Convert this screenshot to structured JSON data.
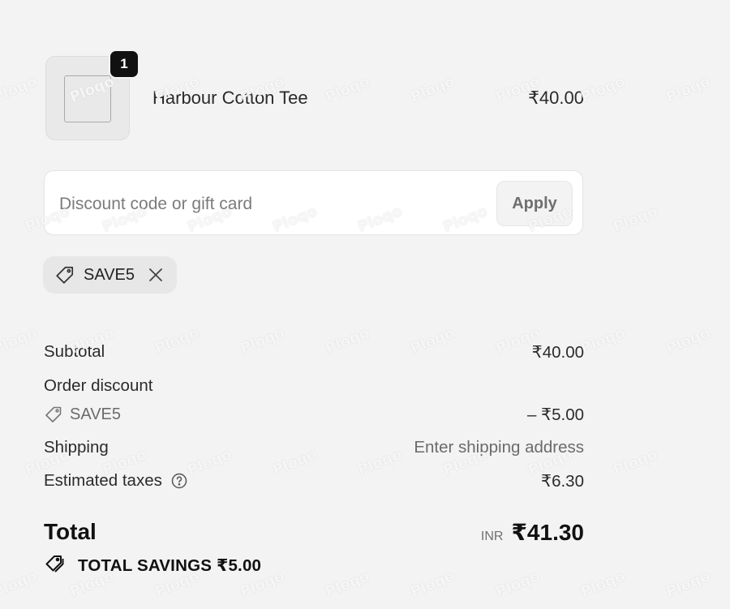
{
  "cart": {
    "quantity_badge": "1",
    "product_name": "Harbour Cotton Tee",
    "product_price": "₹40.00"
  },
  "discount": {
    "placeholder": "Discount code or gift card",
    "value": "",
    "apply_label": "Apply",
    "applied_code": "SAVE5"
  },
  "summary": {
    "subtotal_label": "Subtotal",
    "subtotal_value": "₹40.00",
    "order_discount_label": "Order discount",
    "discount_code": "SAVE5",
    "discount_value": "– ₹5.00",
    "shipping_label": "Shipping",
    "shipping_value": "Enter shipping address",
    "taxes_label": "Estimated taxes",
    "taxes_value": "₹6.30",
    "total_label": "Total",
    "total_currency": "INR",
    "total_value": "₹41.30",
    "savings_text": "TOTAL SAVINGS ₹5.00"
  },
  "watermark": "Ploqo",
  "icons": {
    "product_image": "image-placeholder-icon",
    "tag": "tag-icon",
    "remove": "close-icon",
    "help": "question-circle-icon",
    "savings": "tags-icon"
  }
}
